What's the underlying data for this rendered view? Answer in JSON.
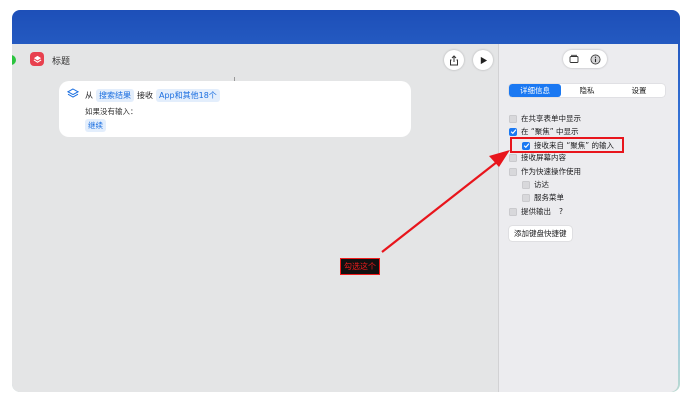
{
  "window": {
    "title": "标题"
  },
  "action": {
    "from": "从",
    "search_results": "搜索结果",
    "receive": "接收",
    "apps": "App和其他18个",
    "if_no_input": "如果没有输入：",
    "continue": "继续"
  },
  "panel": {
    "tabs": [
      {
        "label": "详细信息",
        "active": true
      },
      {
        "label": "隐私",
        "active": false
      },
      {
        "label": "设置",
        "active": false
      }
    ],
    "options": {
      "show_in_share_sheet": {
        "label": "在共享表单中显示",
        "checked": false
      },
      "show_in_focus": {
        "label": "在 “聚焦” 中显示",
        "checked": true
      },
      "receive_from_focus": {
        "label": "接收来自 “聚焦” 的输入",
        "checked": true
      },
      "receive_screen": {
        "label": "接收屏幕内容",
        "checked": false
      },
      "quick_action": {
        "label": "作为快速操作使用",
        "checked": false
      },
      "finder": {
        "label": "访达",
        "checked": false
      },
      "services_menu": {
        "label": "服务菜单",
        "checked": false
      },
      "provide_output": {
        "label": "提供输出",
        "checked": false,
        "help": "?"
      }
    },
    "add_shortcut": "添加键盘快捷键"
  },
  "annotation": {
    "label": "勾选这个"
  },
  "colors": {
    "accent": "#1a78f2",
    "annotation": "#e8151c"
  }
}
